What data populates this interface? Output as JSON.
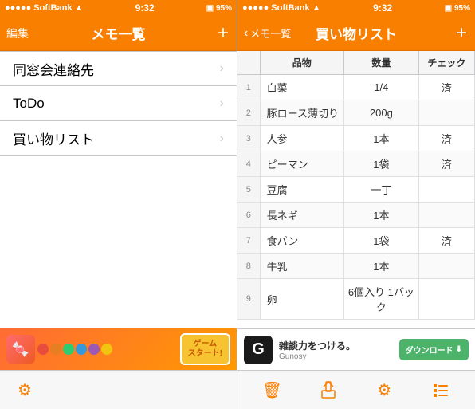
{
  "left": {
    "statusBar": {
      "carrier": "SoftBank",
      "wifi": "WiFi",
      "time": "9:32",
      "signal": "●●●●●",
      "battery": "95%"
    },
    "navBar": {
      "title": "メモ一覧",
      "leftBtn": "編集",
      "rightBtn": "+"
    },
    "listItems": [
      {
        "id": "reunion",
        "label": "同窓会連絡先"
      },
      {
        "id": "todo",
        "label": "ToDo"
      },
      {
        "id": "shopping",
        "label": "買い物リスト"
      }
    ],
    "ad": {
      "gameBtn": "ゲーム\nスタート!"
    },
    "toolbar": {
      "settingsIcon": "⚙"
    }
  },
  "right": {
    "statusBar": {
      "carrier": "SoftBank",
      "time": "9:32",
      "battery": "95%"
    },
    "navBar": {
      "backLabel": "メモ一覧",
      "title": "買い物リスト",
      "rightBtn": "+"
    },
    "tableHeaders": {
      "num": "",
      "item": "品物",
      "qty": "数量",
      "check": "チェック"
    },
    "tableRows": [
      {
        "num": "1",
        "item": "白菜",
        "qty": "1/4",
        "check": "済"
      },
      {
        "num": "2",
        "item": "豚ロース薄切り",
        "qty": "200g",
        "check": ""
      },
      {
        "num": "3",
        "item": "人参",
        "qty": "1本",
        "check": "済"
      },
      {
        "num": "4",
        "item": "ピーマン",
        "qty": "1袋",
        "check": "済"
      },
      {
        "num": "5",
        "item": "豆腐",
        "qty": "一丁",
        "check": ""
      },
      {
        "num": "6",
        "item": "長ネギ",
        "qty": "1本",
        "check": ""
      },
      {
        "num": "7",
        "item": "食パン",
        "qty": "1袋",
        "check": "済"
      },
      {
        "num": "8",
        "item": "牛乳",
        "qty": "1本",
        "check": ""
      },
      {
        "num": "9",
        "item": "卵",
        "qty": "6個入り 1パック",
        "check": ""
      }
    ],
    "ad": {
      "logoLetter": "G",
      "mainText": "雑談力をつける。",
      "subText": "Gunosy",
      "dlBtn": "ダウンロード"
    },
    "toolbar": {
      "trashIcon": "🗑",
      "shareIcon": "⬆",
      "settingsIcon": "⚙",
      "listIcon": "☰"
    }
  }
}
